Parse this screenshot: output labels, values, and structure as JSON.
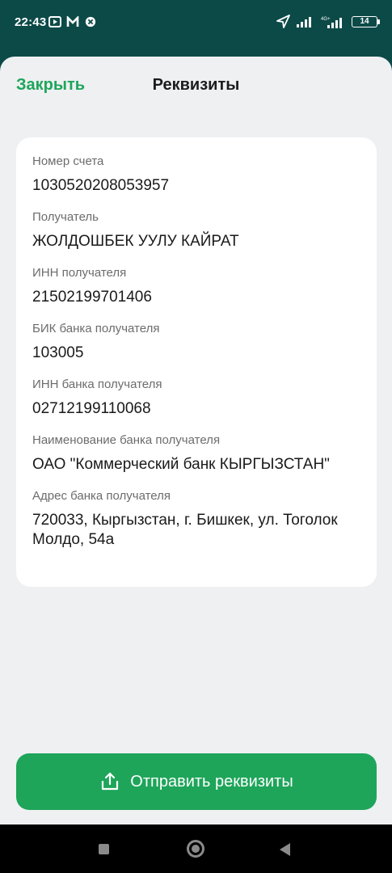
{
  "status_bar": {
    "time": "22:43",
    "battery": "14"
  },
  "header": {
    "close_label": "Закрыть",
    "title": "Реквизиты"
  },
  "details": [
    {
      "label": "Номер счета",
      "value": "1030520208053957"
    },
    {
      "label": "Получатель",
      "value": "ЖОЛДОШБЕК УУЛУ КАЙРАТ"
    },
    {
      "label": "ИНН получателя",
      "value": "21502199701406"
    },
    {
      "label": "БИК банка получателя",
      "value": "103005"
    },
    {
      "label": "ИНН банка получателя",
      "value": "02712199110068"
    },
    {
      "label": "Наименование банка получателя",
      "value": "ОАО \"Коммерческий банк КЫРГЫЗСТАН\""
    },
    {
      "label": "Адрес банка получателя",
      "value": "720033, Кыргызстан, г. Бишкек, ул. Тоголок Молдо, 54а"
    }
  ],
  "actions": {
    "send_label": "Отправить реквизиты"
  },
  "colors": {
    "accent": "#1ea55a",
    "status_bar_bg": "#0c4a48",
    "sheet_bg": "#eef0f2"
  },
  "icons": {
    "share": "share-icon",
    "location": "location-arrow-icon"
  }
}
